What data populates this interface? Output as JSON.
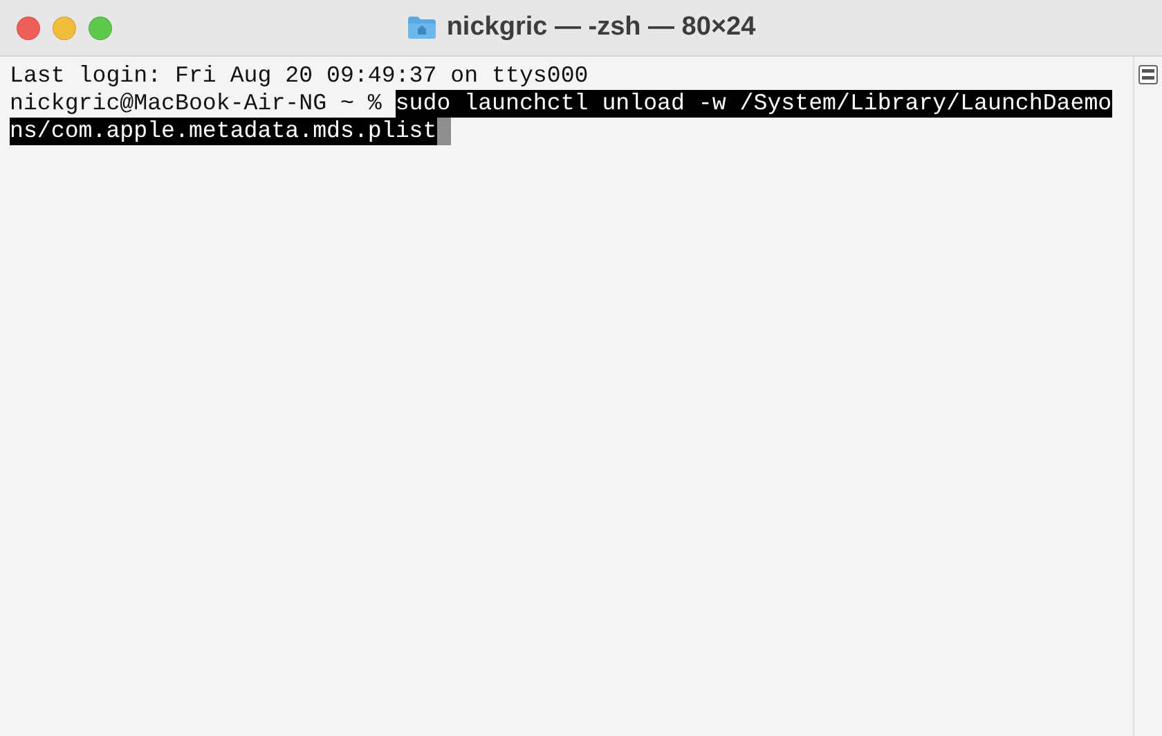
{
  "window": {
    "title": "nickgric — -zsh — 80×24"
  },
  "terminal": {
    "output_lines": [
      "Last login: Fri Aug 20 09:49:37 on ttys000"
    ],
    "prompt": "nickgric@MacBook-Air-NG ~ % ",
    "command": {
      "selected": true,
      "lines": [
        "sudo launchctl unload -w /System/Library/LaunchDaemo",
        "ns/com.apple.metadata.mds.plist"
      ]
    }
  }
}
